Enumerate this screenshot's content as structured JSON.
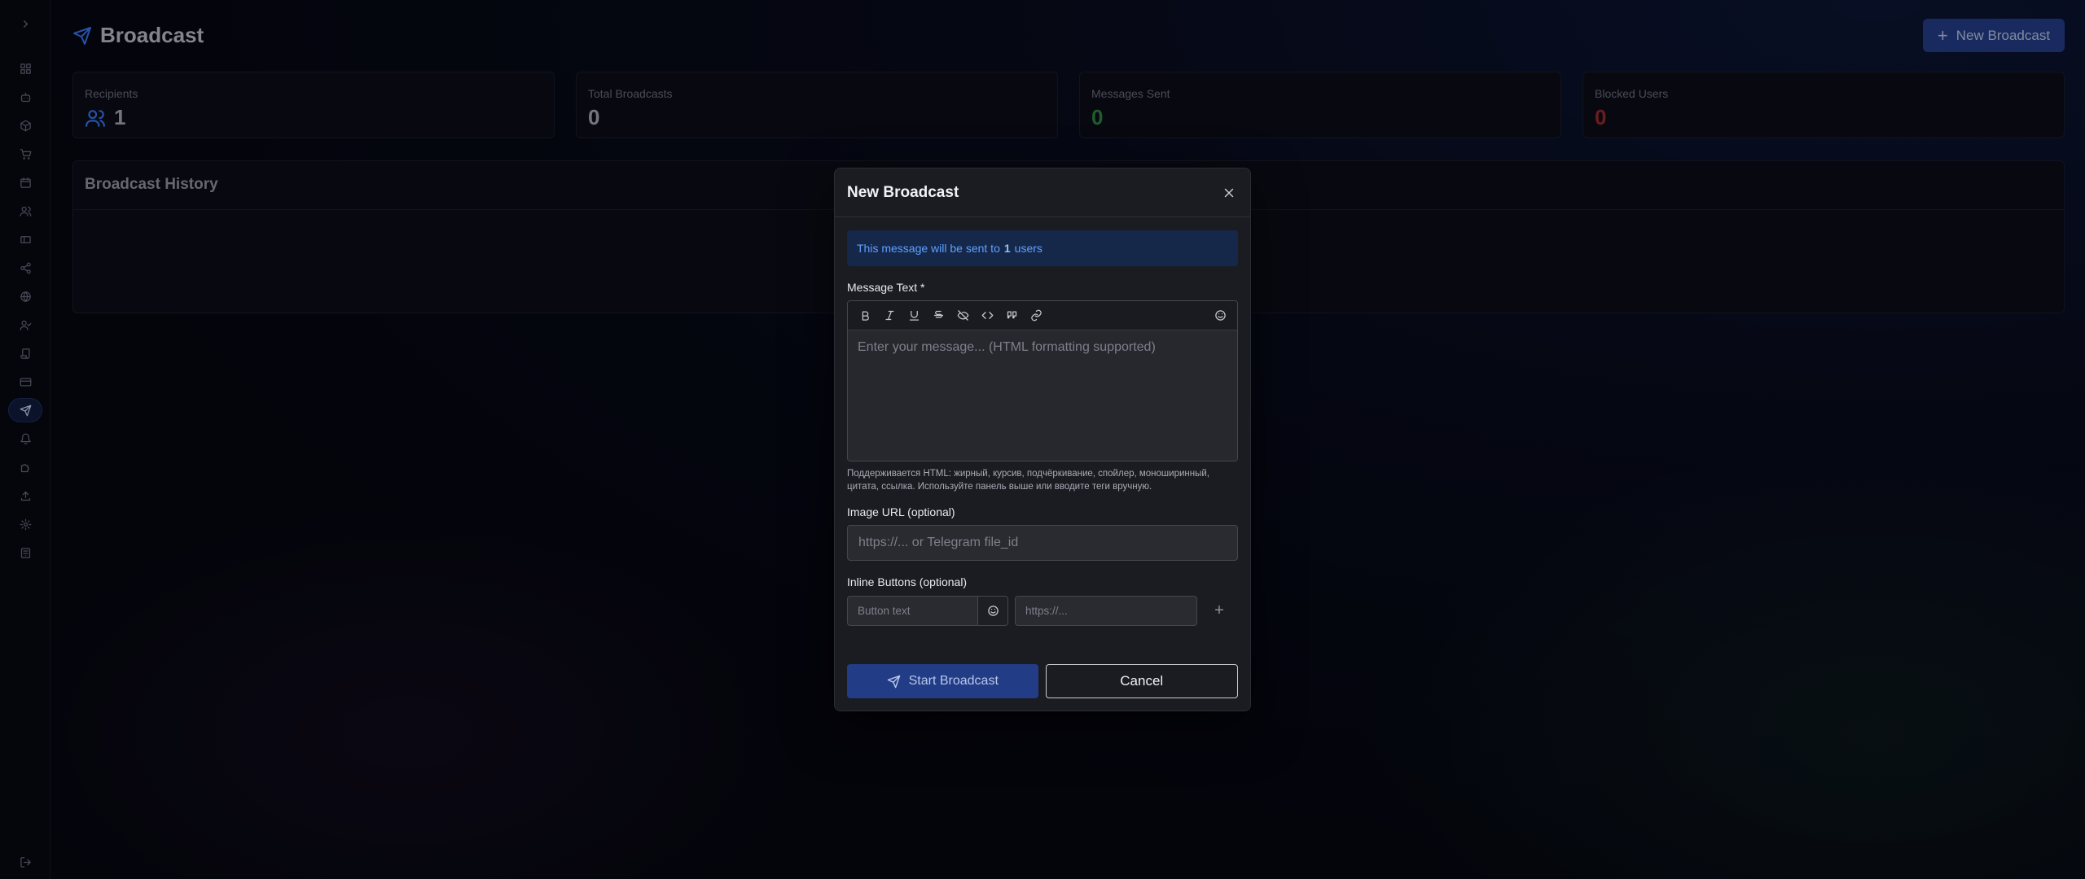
{
  "page": {
    "title": "Broadcast",
    "new_button_label": "New Broadcast",
    "accent": "#3b7dff"
  },
  "sidebar": {
    "items": [
      {
        "icon": "chevron-right-icon"
      },
      {
        "icon": "dashboard-icon"
      },
      {
        "icon": "bot-icon"
      },
      {
        "icon": "package-icon"
      },
      {
        "icon": "cart-icon"
      },
      {
        "icon": "calendar-icon"
      },
      {
        "icon": "users-icon"
      },
      {
        "icon": "ticket-icon"
      },
      {
        "icon": "share-icon"
      },
      {
        "icon": "globe-icon"
      },
      {
        "icon": "user-check-icon"
      },
      {
        "icon": "scroll-icon"
      },
      {
        "icon": "credit-card-icon"
      },
      {
        "icon": "send-icon",
        "active": true
      },
      {
        "icon": "bell-icon"
      },
      {
        "icon": "puzzle-icon"
      },
      {
        "icon": "upload-icon"
      },
      {
        "icon": "settings-icon"
      },
      {
        "icon": "server-icon"
      },
      {
        "icon": "logout-icon"
      }
    ]
  },
  "stats": [
    {
      "label": "Recipients",
      "value": "1"
    },
    {
      "label": "Total Broadcasts",
      "value": "0"
    },
    {
      "label": "Messages Sent",
      "value": "0",
      "color": "#2f8a3f"
    },
    {
      "label": "Blocked Users",
      "value": "0",
      "color": "#a12a2a"
    }
  ],
  "history": {
    "title": "Broadcast History"
  },
  "modal": {
    "title": "New Broadcast",
    "info_prefix": "This message will be sent to",
    "info_count": "1",
    "info_suffix": "users",
    "message_label": "Message Text *",
    "message_placeholder": "Enter your message... (HTML formatting supported)",
    "hint": "Поддерживается HTML: жирный, курсив, подчёркивание, спойлер, моноширинный, цитата, ссылка. Используйте панель выше или вводите теги вручную.",
    "image_label": "Image URL (optional)",
    "image_placeholder": "https://... or Telegram file_id",
    "buttons_label": "Inline Buttons (optional)",
    "button_text_placeholder": "Button text",
    "button_url_placeholder": "https://...",
    "add_symbol": "+",
    "start_label": "Start Broadcast",
    "cancel_label": "Cancel"
  }
}
